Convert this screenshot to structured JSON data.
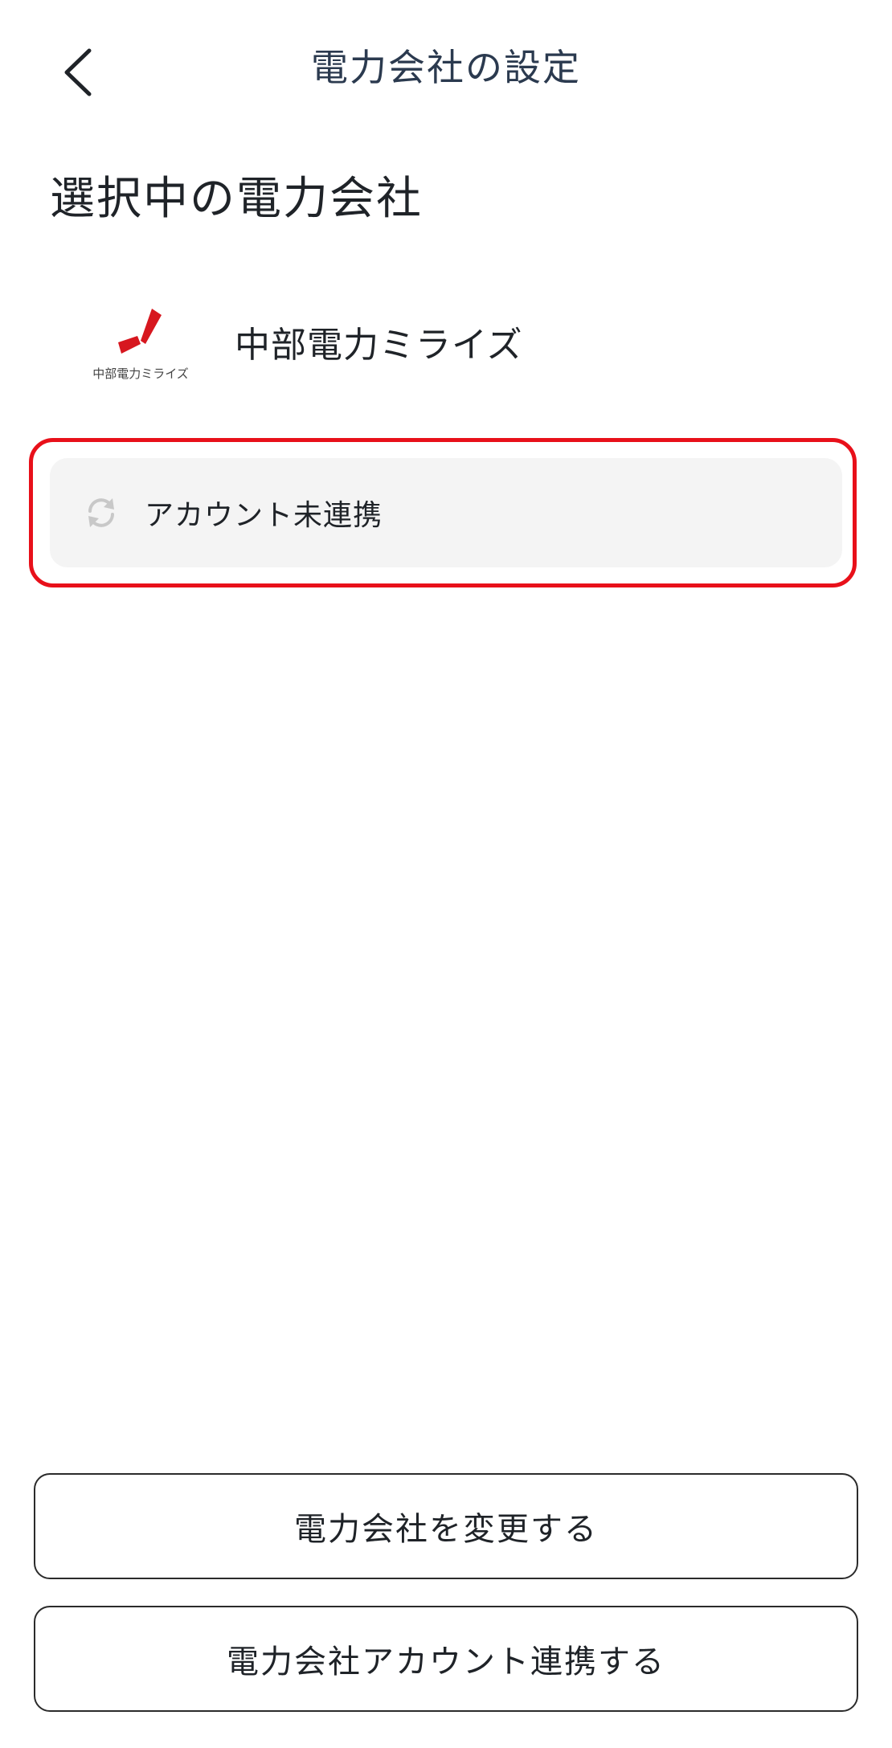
{
  "header": {
    "title": "電力会社の設定",
    "back_icon": "chevron-left-icon"
  },
  "section": {
    "title": "選択中の電力会社"
  },
  "provider": {
    "name": "中部電力ミライズ",
    "logo_text": "中部電力ミライズ",
    "logo_color": "#d7171f"
  },
  "status": {
    "icon": "sync-icon",
    "text": "アカウント未連携",
    "highlight_color": "#e8101a"
  },
  "buttons": {
    "change_label": "電力会社を変更する",
    "link_label": "電力会社アカウント連携する"
  }
}
